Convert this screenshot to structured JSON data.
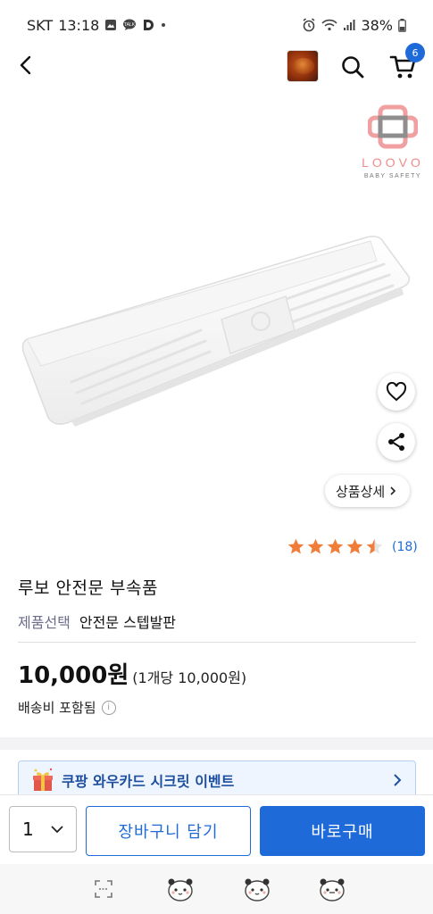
{
  "status_bar": {
    "carrier": "SKT",
    "time": "13:18",
    "battery": "38%"
  },
  "header": {
    "back_icon": "back-arrow-icon",
    "search_icon": "search-icon",
    "cart_icon": "cart-icon",
    "cart_count": "6"
  },
  "product": {
    "brand_logo_text": "LOOVO",
    "brand_logo_sub": "BABY SAFETY",
    "detail_label": "상품상세",
    "rating": 4.5,
    "review_count": "(18)",
    "title": "루보 안전문 부속품",
    "option_key": "제품선택",
    "option_value": "안전문 스텝발판",
    "price": "10,000원",
    "unit_price": "(1개당 10,000원)",
    "shipping": "배송비 포함됨"
  },
  "promo": {
    "text": "쿠팡 와우카드 시크릿 이벤트"
  },
  "purchase": {
    "quantity": "1",
    "add_to_cart": "장바구니 담기",
    "buy_now": "바로구매"
  },
  "colors": {
    "accent": "#1e6ad8",
    "star": "#f07d3a",
    "brand_pink": "#f08a8a"
  }
}
